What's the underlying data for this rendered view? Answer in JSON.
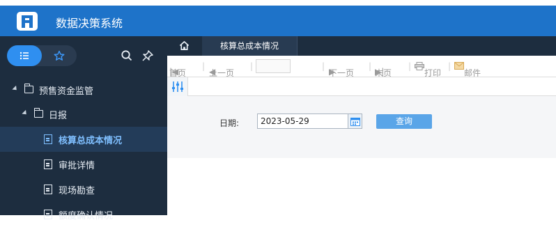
{
  "app": {
    "title": "数据决策系统",
    "logo": "brand-logo"
  },
  "sidebar": {
    "mode_buttons": [
      {
        "icon": "list-icon",
        "active": true
      },
      {
        "icon": "star-icon",
        "active": false
      }
    ],
    "tools": [
      "search-icon",
      "pin-icon"
    ],
    "tree": [
      {
        "label": "预售资金监管",
        "type": "folder",
        "expanded": true,
        "level": 0
      },
      {
        "label": "日报",
        "type": "folder",
        "expanded": true,
        "level": 1
      },
      {
        "label": "核算总成本情况",
        "type": "report",
        "active": true,
        "level": 2
      },
      {
        "label": "审批详情",
        "type": "report",
        "level": 2
      },
      {
        "label": "现场勘查",
        "type": "report",
        "level": 2
      },
      {
        "label": "额度确认情况",
        "type": "report",
        "level": 2
      }
    ]
  },
  "tabs": {
    "home_icon": "home-icon",
    "active_tab": "核算总成本情况"
  },
  "toolbar": {
    "first": "首页",
    "prev": "上一页",
    "page_value": "",
    "next": "下一页",
    "last": "末页",
    "print": "打印",
    "mail": "邮件"
  },
  "filter": {
    "icon": "sliders-icon"
  },
  "form": {
    "date_label": "日期:",
    "date_value": "2023-05-29",
    "query_label": "查询"
  },
  "colors": {
    "header": "#1e73c9",
    "sidebar": "#1d2d3f",
    "accent": "#2f8ff0",
    "annotation": "#e0201b"
  }
}
